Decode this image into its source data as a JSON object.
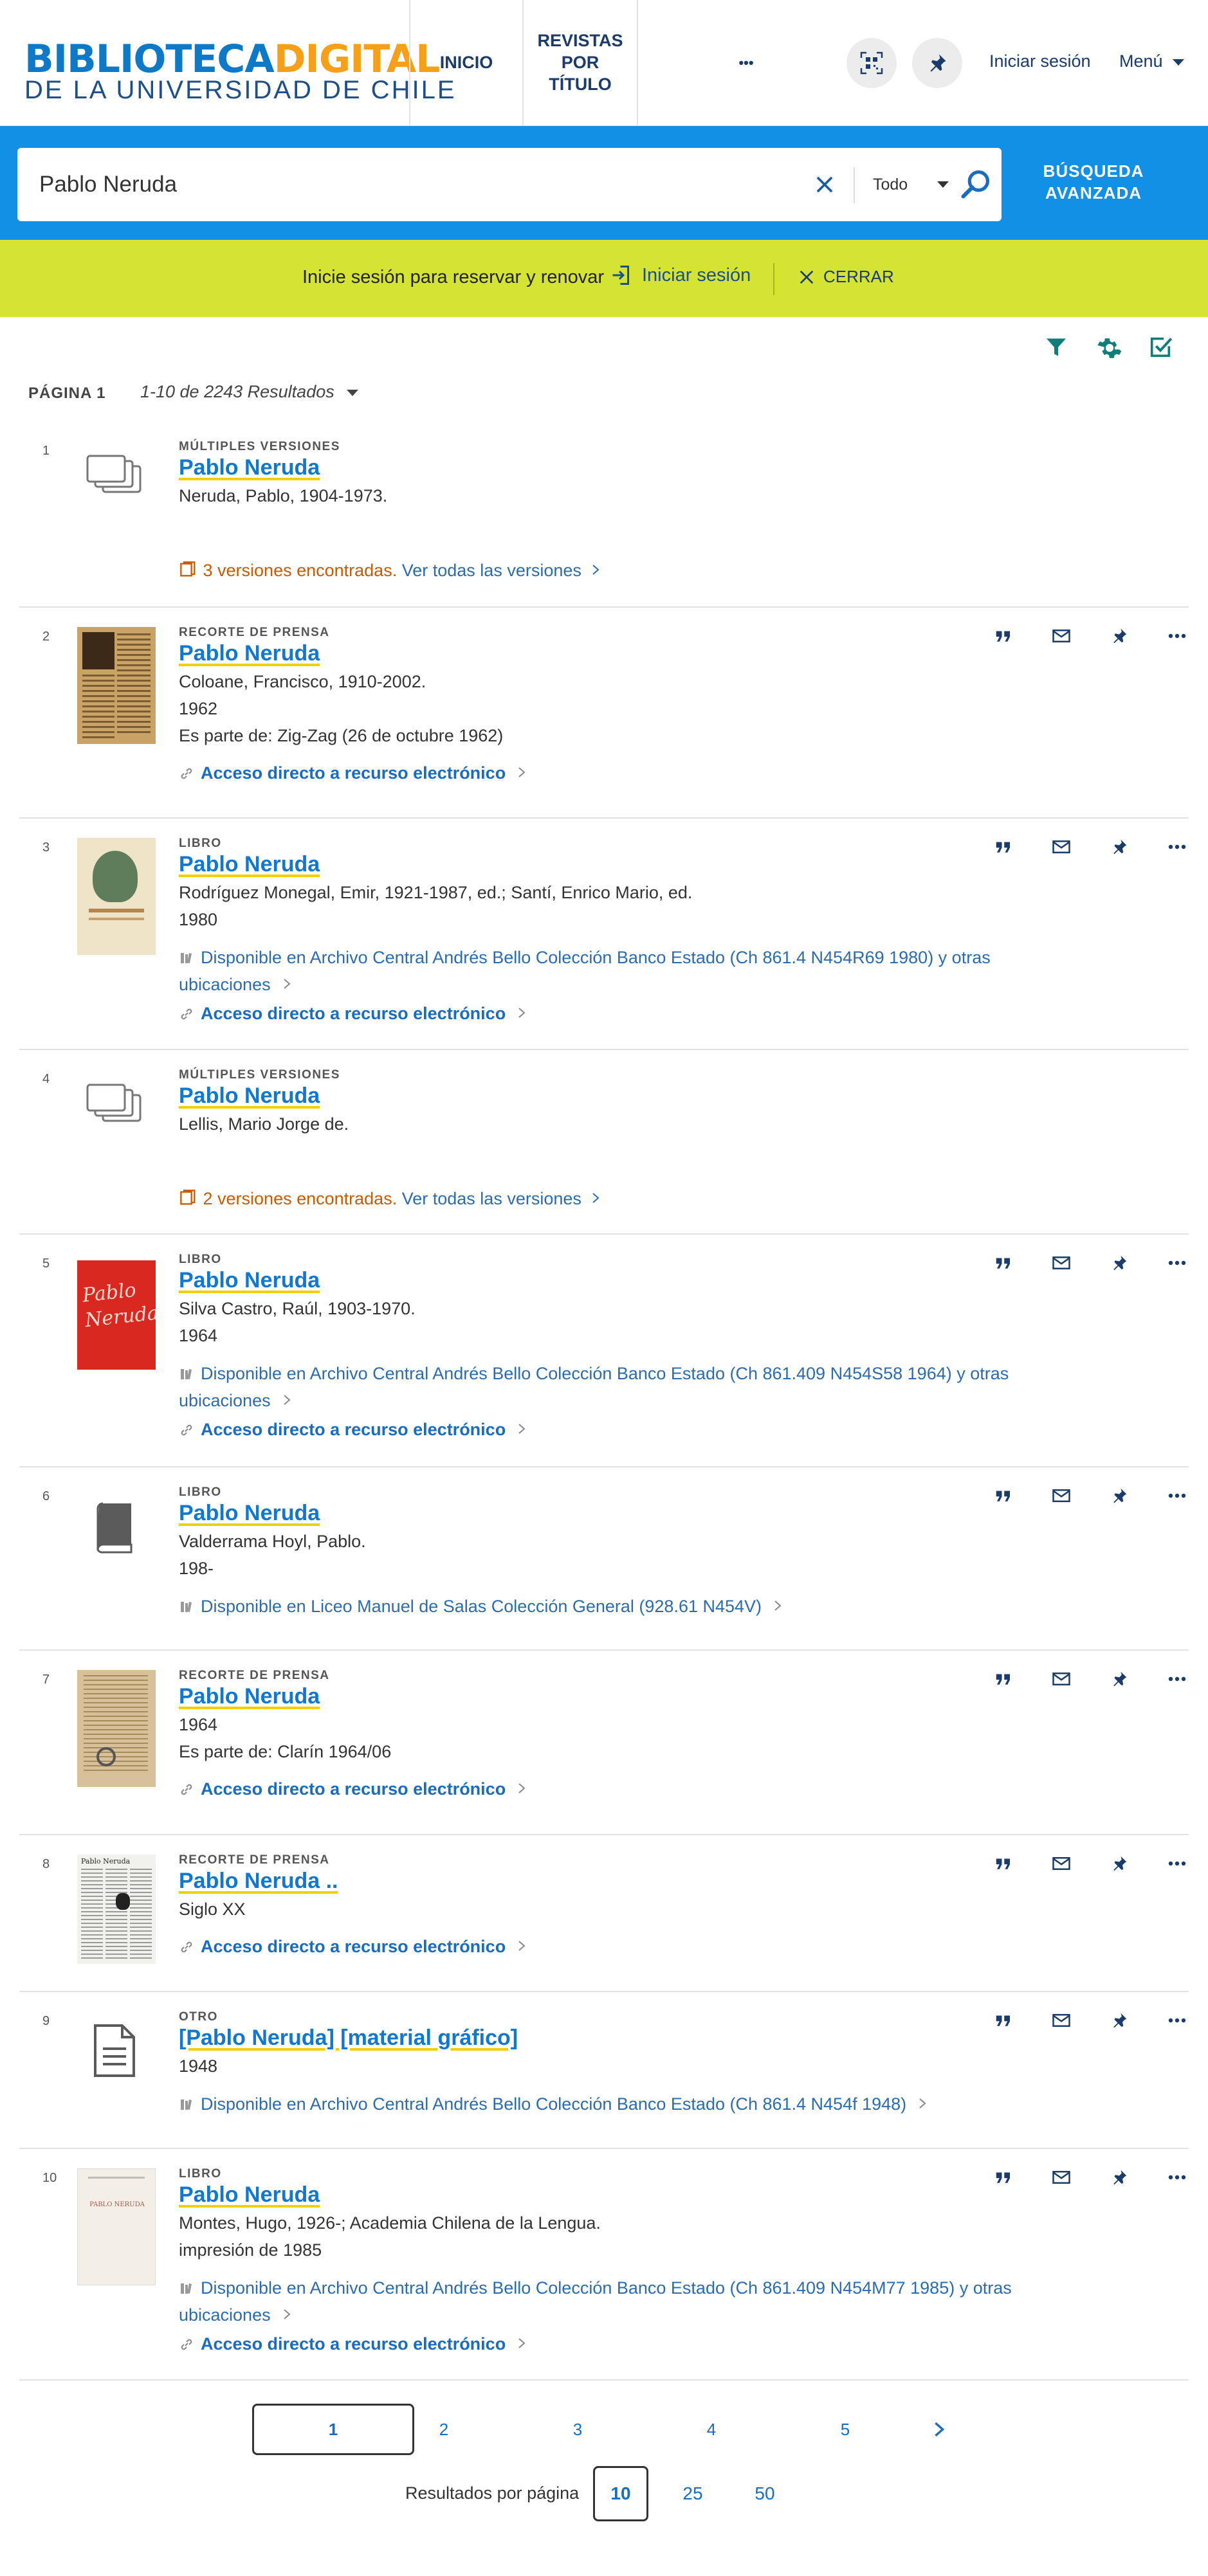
{
  "header": {
    "logo_top_a": "BIBLIOTECA",
    "logo_top_b": "DIGITAL",
    "logo_bottom": "DE LA UNIVERSIDAD DE CHILE",
    "nav": [
      "INICIO",
      "REVISTAS POR TÍTULO",
      "•••"
    ],
    "signin": "Iniciar sesión",
    "menu": "Menú"
  },
  "search": {
    "query": "Pablo Neruda",
    "scope": "Todo",
    "advanced": "BÚSQUEDA AVANZADA"
  },
  "banner": {
    "text": "Inicie sesión para reservar y renovar",
    "signin": "Iniciar sesión",
    "close": "CERRAR"
  },
  "results_header": {
    "page": "PÁGINA 1",
    "count": "1-10 de 2243 Resultados"
  },
  "results": [
    {
      "num": "1",
      "type": "MÚLTIPLES VERSIONES",
      "title": "Pablo Neruda",
      "lines": [
        "Neruda, Pablo, 1904-1973."
      ],
      "versions": "3 versiones encontradas.",
      "versions_link": "Ver todas las versiones"
    },
    {
      "num": "2",
      "type": "RECORTE DE PRENSA",
      "title": "Pablo Neruda",
      "lines": [
        "Coloane, Francisco, 1910-2002.",
        "1962",
        "Es parte de: Zig-Zag (26 de octubre 1962)"
      ],
      "access": "Acceso directo a recurso electrónico"
    },
    {
      "num": "3",
      "type": "LIBRO",
      "title": "Pablo Neruda",
      "lines": [
        "Rodríguez Monegal, Emir, 1921-1987, ed.; Santí, Enrico Mario, ed.",
        "1980"
      ],
      "avail": "Disponible en Archivo Central Andrés Bello  Colección Banco Estado (Ch 861.4 N454R69 1980) y otras",
      "avail2": "ubicaciones",
      "access": "Acceso directo a recurso electrónico"
    },
    {
      "num": "4",
      "type": "MÚLTIPLES VERSIONES",
      "title": "Pablo Neruda",
      "lines": [
        "Lellis, Mario Jorge de."
      ],
      "versions": "2 versiones encontradas.",
      "versions_link": "Ver todas las versiones"
    },
    {
      "num": "5",
      "type": "LIBRO",
      "title": "Pablo Neruda",
      "lines": [
        "Silva Castro, Raúl, 1903-1970.",
        "1964"
      ],
      "avail": "Disponible en Archivo Central Andrés Bello  Colección Banco Estado (Ch 861.409 N454S58 1964) y otras",
      "avail2": "ubicaciones",
      "access": "Acceso directo a recurso electrónico"
    },
    {
      "num": "6",
      "type": "LIBRO",
      "title": "Pablo Neruda",
      "lines": [
        "Valderrama Hoyl, Pablo.",
        "198-"
      ],
      "avail": "Disponible en Liceo Manuel de Salas  Colección General (928.61 N454V)"
    },
    {
      "num": "7",
      "type": "RECORTE DE PRENSA",
      "title": "Pablo Neruda",
      "lines": [
        "1964",
        "Es parte de: Clarín 1964/06"
      ],
      "access": "Acceso directo a recurso electrónico"
    },
    {
      "num": "8",
      "type": "RECORTE DE PRENSA",
      "title": "Pablo Neruda ..",
      "lines": [
        "Siglo XX"
      ],
      "access": "Acceso directo a recurso electrónico"
    },
    {
      "num": "9",
      "type": "OTRO",
      "title": "[Pablo Neruda] [material gráfico]",
      "lines": [
        "1948"
      ],
      "avail": "Disponible en Archivo Central Andrés Bello  Colección Banco Estado (Ch 861.4 N454f 1948)"
    },
    {
      "num": "10",
      "type": "LIBRO",
      "title": "Pablo Neruda",
      "lines": [
        "Montes, Hugo, 1926-; Academia Chilena de la Lengua.",
        "impresión de 1985"
      ],
      "avail": "Disponible en Archivo Central Andrés Bello  Colección Banco Estado (Ch 861.409 N454M77 1985) y otras",
      "avail2": "ubicaciones",
      "access": "Acceso directo a recurso electrónico"
    }
  ],
  "thumb_text": {
    "r5": "Pablo Neruda",
    "r8": "Pablo Neruda",
    "r10": "PABLO NERUDA"
  },
  "pagination": {
    "pages": [
      "1",
      "2",
      "3",
      "4",
      "5"
    ],
    "per_page_label": "Resultados por página",
    "per_page": [
      "10",
      "25",
      "50"
    ]
  },
  "colors": {
    "brand_blue": "#1290e6",
    "banner": "#d5e433",
    "link": "#1177cf",
    "highlight": "#f2cf00",
    "versions": "#cc5a00"
  }
}
